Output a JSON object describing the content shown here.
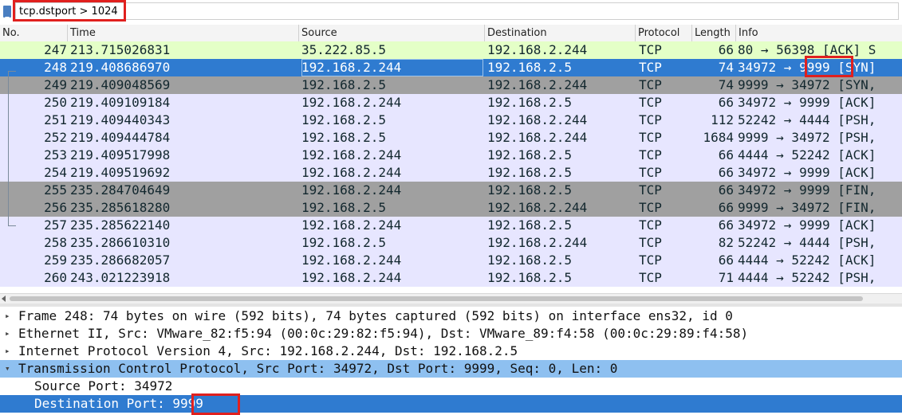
{
  "filter": {
    "value": "tcp.dstport > 1024",
    "highlight_color": "#e0201e"
  },
  "columns": [
    "No.",
    "Time",
    "Source",
    "Destination",
    "Protocol",
    "Length",
    "Info"
  ],
  "packets": [
    {
      "no": "247",
      "time": "213.715026831",
      "src": "35.222.85.5",
      "dst": "192.168.2.244",
      "proto": "TCP",
      "len": "66",
      "info": "80 → 56398 [ACK] S",
      "bg": "#e4ffc7",
      "fg": "#12272e"
    },
    {
      "no": "248",
      "time": "219.408686970",
      "src": "192.168.2.244",
      "dst": "192.168.2.5",
      "proto": "TCP",
      "len": "74",
      "info": "34972 → 9999 [SYN]",
      "bg": "#2f7bd0",
      "fg": "#ffffff"
    },
    {
      "no": "249",
      "time": "219.409048569",
      "src": "192.168.2.5",
      "dst": "192.168.2.244",
      "proto": "TCP",
      "len": "74",
      "info": "9999 → 34972 [SYN,",
      "bg": "#a0a0a0",
      "fg": "#12272e"
    },
    {
      "no": "250",
      "time": "219.409109184",
      "src": "192.168.2.244",
      "dst": "192.168.2.5",
      "proto": "TCP",
      "len": "66",
      "info": "34972 → 9999 [ACK]",
      "bg": "#e7e6ff",
      "fg": "#12272e"
    },
    {
      "no": "251",
      "time": "219.409440343",
      "src": "192.168.2.5",
      "dst": "192.168.2.244",
      "proto": "TCP",
      "len": "112",
      "info": "52242 → 4444 [PSH,",
      "bg": "#e7e6ff",
      "fg": "#12272e"
    },
    {
      "no": "252",
      "time": "219.409444784",
      "src": "192.168.2.5",
      "dst": "192.168.2.244",
      "proto": "TCP",
      "len": "1684",
      "info": "9999 → 34972 [PSH,",
      "bg": "#e7e6ff",
      "fg": "#12272e"
    },
    {
      "no": "253",
      "time": "219.409517998",
      "src": "192.168.2.244",
      "dst": "192.168.2.5",
      "proto": "TCP",
      "len": "66",
      "info": "4444 → 52242 [ACK]",
      "bg": "#e7e6ff",
      "fg": "#12272e"
    },
    {
      "no": "254",
      "time": "219.409519692",
      "src": "192.168.2.244",
      "dst": "192.168.2.5",
      "proto": "TCP",
      "len": "66",
      "info": "34972 → 9999 [ACK]",
      "bg": "#e7e6ff",
      "fg": "#12272e"
    },
    {
      "no": "255",
      "time": "235.284704649",
      "src": "192.168.2.244",
      "dst": "192.168.2.5",
      "proto": "TCP",
      "len": "66",
      "info": "34972 → 9999 [FIN,",
      "bg": "#a0a0a0",
      "fg": "#12272e"
    },
    {
      "no": "256",
      "time": "235.285618280",
      "src": "192.168.2.5",
      "dst": "192.168.2.244",
      "proto": "TCP",
      "len": "66",
      "info": "9999 → 34972 [FIN,",
      "bg": "#a0a0a0",
      "fg": "#12272e"
    },
    {
      "no": "257",
      "time": "235.285622140",
      "src": "192.168.2.244",
      "dst": "192.168.2.5",
      "proto": "TCP",
      "len": "66",
      "info": "34972 → 9999 [ACK]",
      "bg": "#e7e6ff",
      "fg": "#12272e"
    },
    {
      "no": "258",
      "time": "235.286610310",
      "src": "192.168.2.5",
      "dst": "192.168.2.244",
      "proto": "TCP",
      "len": "82",
      "info": "52242 → 4444 [PSH,",
      "bg": "#e7e6ff",
      "fg": "#12272e"
    },
    {
      "no": "259",
      "time": "235.286682057",
      "src": "192.168.2.244",
      "dst": "192.168.2.5",
      "proto": "TCP",
      "len": "66",
      "info": "4444 → 52242 [ACK]",
      "bg": "#e7e6ff",
      "fg": "#12272e"
    },
    {
      "no": "260",
      "time": "243.021223918",
      "src": "192.168.2.244",
      "dst": "192.168.2.5",
      "proto": "TCP",
      "len": "71",
      "info": "4444 → 52242 [PSH,",
      "bg": "#e7e6ff",
      "fg": "#12272e"
    }
  ],
  "details": [
    {
      "arrow": "▸",
      "indent": 0,
      "text": "Frame 248: 74 bytes on wire (592 bits), 74 bytes captured (592 bits) on interface ens32, id 0",
      "state": "normal"
    },
    {
      "arrow": "▸",
      "indent": 0,
      "text": "Ethernet II, Src: VMware_82:f5:94 (00:0c:29:82:f5:94), Dst: VMware_89:f4:58 (00:0c:29:89:f4:58)",
      "state": "normal"
    },
    {
      "arrow": "▸",
      "indent": 0,
      "text": "Internet Protocol Version 4, Src: 192.168.2.244, Dst: 192.168.2.5",
      "state": "normal"
    },
    {
      "arrow": "▾",
      "indent": 0,
      "text": "Transmission Control Protocol, Src Port: 34972, Dst Port: 9999, Seq: 0, Len: 0",
      "state": "header"
    },
    {
      "arrow": "",
      "indent": 1,
      "text": "Source Port: 34972",
      "state": "normal"
    },
    {
      "arrow": "",
      "indent": 1,
      "text": "Destination Port: 9999",
      "state": "field"
    }
  ]
}
